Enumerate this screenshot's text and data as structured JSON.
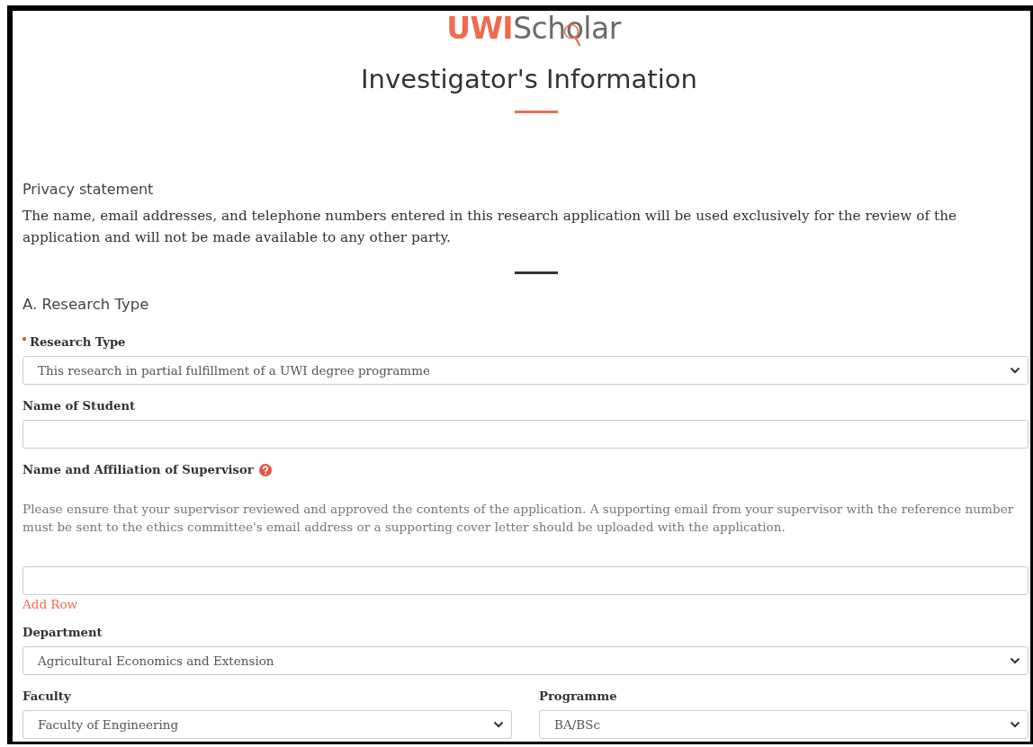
{
  "logo": {
    "primary": "UWI",
    "secondary": "Scholar"
  },
  "title": "Investigator's Information",
  "privacy": {
    "heading": "Privacy statement",
    "text": "The name, email addresses, and telephone numbers entered in this research application will be used exclusively for the review of the application and will not be made available to any other party."
  },
  "section": {
    "heading": "A. Research Type"
  },
  "rows": [
    {
      "fields": [
        {
          "kind": "select",
          "label": "Research Type",
          "required": true,
          "help": false,
          "value": "This research in partial fulfillment of a UWI degree programme"
        }
      ]
    },
    {
      "fields": [
        {
          "kind": "text",
          "label": "Name of Student",
          "required": false,
          "help": false
        }
      ]
    },
    {
      "fields": [
        {
          "kind": "text",
          "label": "Name and Affiliation of Supervisor",
          "required": false,
          "help": true,
          "note": "Please ensure that your supervisor reviewed and approved the contents of the application. A supporting email from your supervisor with the reference number must be sent to the ethics committee's email address or a supporting cover letter should be uploaded with the application.",
          "link": "Add Row"
        }
      ]
    },
    {
      "fields": [
        {
          "kind": "select",
          "label": "Department",
          "required": false,
          "help": false,
          "value": "Agricultural Economics and Extension"
        }
      ]
    },
    {
      "fields": [
        {
          "kind": "select",
          "label": "Faculty",
          "required": false,
          "help": false,
          "value": "Faculty of Engineering"
        },
        {
          "kind": "select",
          "label": "Programme",
          "required": false,
          "help": false,
          "value": "BA/BSc"
        }
      ]
    }
  ]
}
